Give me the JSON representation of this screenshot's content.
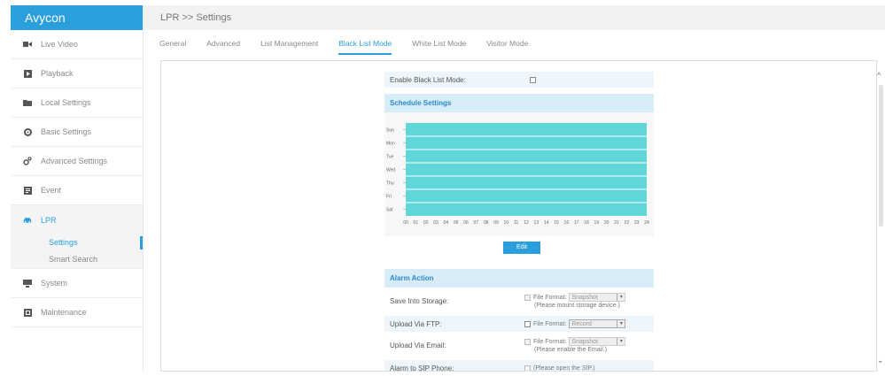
{
  "app": {
    "logo": "Avycon"
  },
  "sidebar": {
    "items": [
      {
        "label": "Live Video",
        "icon": "camera-icon"
      },
      {
        "label": "Playback",
        "icon": "playback-icon"
      },
      {
        "label": "Local Settings",
        "icon": "folder-icon"
      },
      {
        "label": "Basic Settings",
        "icon": "gear-icon"
      },
      {
        "label": "Advanced Settings",
        "icon": "advanced-gear-icon"
      },
      {
        "label": "Event",
        "icon": "event-icon"
      },
      {
        "label": "LPR",
        "icon": "car-icon",
        "active": true
      },
      {
        "label": "System",
        "icon": "system-icon"
      },
      {
        "label": "Maintenance",
        "icon": "maintenance-icon"
      }
    ],
    "lpr_sub": [
      {
        "label": "Settings",
        "active": true
      },
      {
        "label": "Smart Search"
      }
    ]
  },
  "header": {
    "breadcrumb": "LPR >> Settings"
  },
  "tabs": [
    {
      "label": "General"
    },
    {
      "label": "Advanced"
    },
    {
      "label": "List Management"
    },
    {
      "label": "Black List Mode",
      "active": true
    },
    {
      "label": "White List Mode"
    },
    {
      "label": "Visitor Mode"
    }
  ],
  "form": {
    "enable_label": "Enable Black List Mode:",
    "enable_checked": false,
    "schedule_title": "Schedule Settings",
    "edit_label": "Edit",
    "alarm_title": "Alarm Action",
    "alarm_rows": [
      {
        "label": "Save Into Storage:",
        "format_label": "File Format:",
        "format_value": "Snapshot",
        "note": "(Please mount storage device.)",
        "disabled": true
      },
      {
        "label": "Upload Via FTP:",
        "format_label": "File Format:",
        "format_value": "Record",
        "note": "",
        "disabled": false
      },
      {
        "label": "Upload Via Email:",
        "format_label": "File Format:",
        "format_value": "Snapshot",
        "note": "(Please enable the Email.)",
        "disabled": true
      },
      {
        "label": "Alarm to SIP Phone:",
        "format_label": "",
        "format_value": "",
        "note": "(Please open the SIP.)",
        "disabled": true
      }
    ]
  },
  "chart_data": {
    "type": "heatmap",
    "title": "Schedule Settings",
    "days": [
      "Sun",
      "Mon",
      "Tue",
      "Wed",
      "Thu",
      "Fri",
      "Sat"
    ],
    "hours": [
      "00",
      "01",
      "02",
      "03",
      "04",
      "05",
      "06",
      "07",
      "08",
      "09",
      "10",
      "11",
      "12",
      "13",
      "14",
      "15",
      "16",
      "17",
      "18",
      "19",
      "20",
      "21",
      "22",
      "23",
      "24"
    ],
    "schedule": [
      {
        "day": "Sun",
        "start": 0,
        "end": 24
      },
      {
        "day": "Mon",
        "start": 0,
        "end": 24
      },
      {
        "day": "Tue",
        "start": 0,
        "end": 24
      },
      {
        "day": "Wed",
        "start": 0,
        "end": 24
      },
      {
        "day": "Thu",
        "start": 0,
        "end": 24
      },
      {
        "day": "Fri",
        "start": 0,
        "end": 24
      },
      {
        "day": "Sat",
        "start": 0,
        "end": 24
      }
    ],
    "fill_color": "#5fd6d8"
  },
  "colors": {
    "accent": "#2a9fdc",
    "schedule_fill": "#5fd6d8"
  }
}
